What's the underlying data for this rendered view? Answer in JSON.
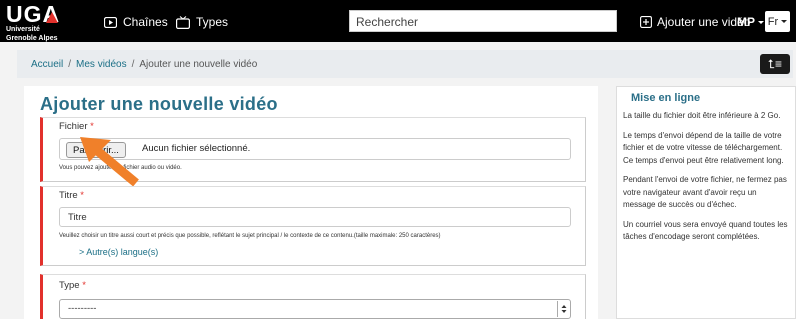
{
  "header": {
    "logo_mark": "UGA",
    "logo_line1": "Université",
    "logo_line2": "Grenoble Alpes",
    "nav_chaines": "Chaînes",
    "nav_types": "Types",
    "search_placeholder": "Rechercher",
    "add_video": "Ajouter une vidéo",
    "user_initials": "MP",
    "language": "Fr"
  },
  "breadcrumb": {
    "home": "Accueil",
    "my_videos": "Mes vidéos",
    "current": "Ajouter une nouvelle vidéo",
    "sep": "/"
  },
  "toc_button": "⮤≡",
  "main": {
    "title": "Ajouter une nouvelle vidéo",
    "file": {
      "label": "Fichier",
      "required": "*",
      "browse_button": "Parcourir...",
      "status": "Aucun fichier sélectionné.",
      "help": "Vous pouvez ajouter un fichier audio ou vidéo."
    },
    "title_field": {
      "label": "Titre",
      "required": "*",
      "value": "Titre",
      "help": "Veuillez choisir un titre aussi court et précis que possible, reflétant le sujet principal / le contexte de ce contenu.(taille maximale: 250 caractères)",
      "other_languages": "> Autre(s) langue(s)"
    },
    "type_field": {
      "label": "Type",
      "required": "*",
      "selected": "---------"
    }
  },
  "sidebar": {
    "title": "Mise en ligne",
    "paragraphs": [
      "La taille du fichier doit être inférieure à 2 Go.",
      "Le temps d'envoi dépend de la taille de votre fichier et de votre vitesse de téléchargement. Ce temps d'envoi peut être relativement long.",
      "Pendant l'envoi de votre fichier, ne fermez pas votre navigateur avant d'avoir reçu un message de succès ou d'échec.",
      "Un courriel vous sera envoyé quand toutes les tâches d'encodage seront complétées."
    ]
  },
  "colors": {
    "nav_bg": "#000000",
    "accent_red": "#e2312c",
    "title_blue": "#2b6f88",
    "link_blue": "#1b6f86",
    "arrow_orange": "#f0802a"
  },
  "icons": {
    "chaines": "play-box-icon",
    "types": "tv-icon",
    "add_video": "plus-box-icon",
    "pointer": "orange-arrow-icon"
  }
}
